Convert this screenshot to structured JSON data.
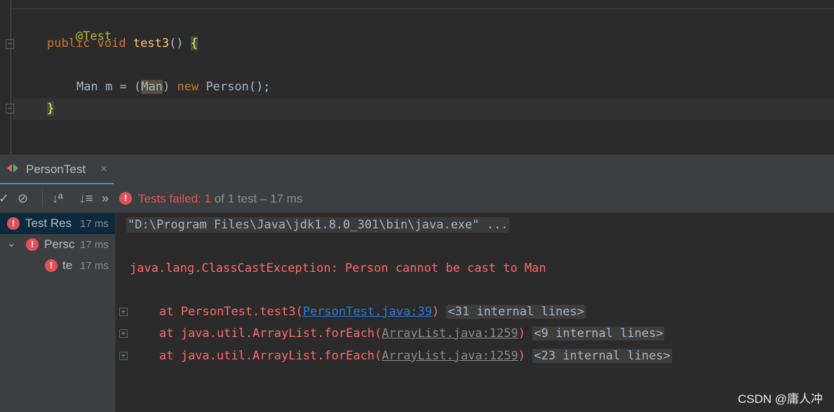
{
  "editor": {
    "annotation": "@Test",
    "signature": {
      "kw_public": "public",
      "kw_void": "void",
      "method": "test3",
      "parens": "()",
      "brace_open": "{"
    },
    "statement": {
      "type": "Man",
      "var": "m",
      "eq": "=",
      "cast_open": "(",
      "cast_type": "Man",
      "cast_close": ")",
      "kw_new": "new",
      "ctor": "Person",
      "tail": "();"
    },
    "brace_close": "}"
  },
  "tool_window": {
    "tab_label": "PersonTest",
    "tab_close": "×"
  },
  "toolbar": {
    "icons": [
      "check-icon",
      "stop-icon",
      "sort-alpha-icon",
      "sort-duration-icon",
      "more-icon"
    ],
    "more": "»",
    "status_failed": "Tests failed:",
    "status_count": "1",
    "status_rest": "of 1 test – 17 ms"
  },
  "tree": {
    "items": [
      {
        "label": "Test Res",
        "time": "17 ms"
      },
      {
        "label": "Persc",
        "time": "17 ms"
      },
      {
        "label": "te",
        "time": "17 ms"
      }
    ]
  },
  "console": {
    "command": "\"D:\\Program Files\\Java\\jdk1.8.0_301\\bin\\java.exe\" ...",
    "exception": "java.lang.ClassCastException: Person cannot be cast to Man",
    "stack": [
      {
        "prefix": "at PersonTest.test3(",
        "link": "PersonTest.java:39",
        "suffix": ")",
        "internal": "<31 internal lines>"
      },
      {
        "prefix": "at java.util.ArrayList.forEach(",
        "link": "ArrayList.java:1259",
        "suffix": ")",
        "internal": "<9 internal lines>"
      },
      {
        "prefix": "at java.util.ArrayList.forEach(",
        "link": "ArrayList.java:1259",
        "suffix": ")",
        "internal": "<23 internal lines>"
      }
    ]
  },
  "watermark": "CSDN @庸人冲",
  "colors": {
    "error": "#e0525a",
    "link": "#287bde",
    "keyword": "#cc7832",
    "annotation": "#bbb529",
    "method": "#ffc66d"
  }
}
